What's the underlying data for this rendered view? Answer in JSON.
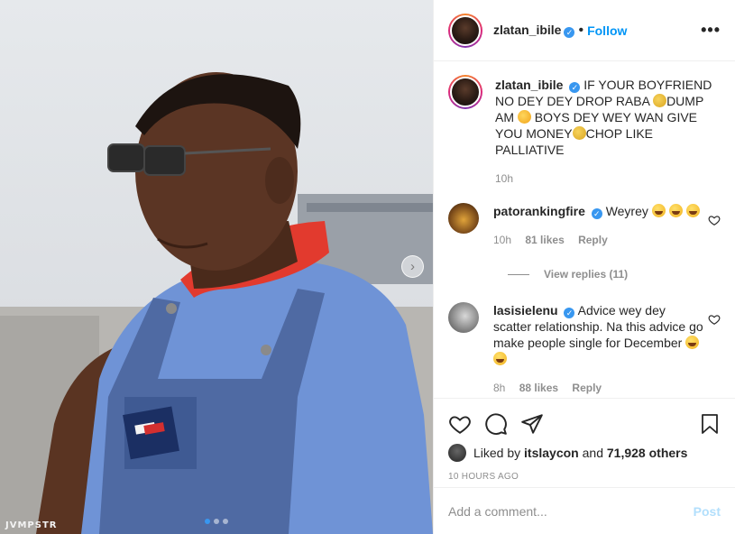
{
  "photo": {
    "watermark": "JVMPSTR",
    "next_arrow": "›",
    "carousel": {
      "slides": 3,
      "active": 1
    }
  },
  "header": {
    "username": "zlatan_ibile",
    "verified_glyph": "✓",
    "separator": "•",
    "follow_label": "Follow",
    "more_glyph": "•••"
  },
  "caption": {
    "username": "zlatan_ibile",
    "text_1": "IF YOUR BOYFRIEND NO DEY DEY DROP RABA ",
    "text_2": "DUMP AM ",
    "text_3": " BOYS DEY WEY WAN GIVE YOU MONEY",
    "text_4": "CHOP LIKE PALLIATIVE",
    "time": "10h"
  },
  "comments": [
    {
      "username": "patorankingfire",
      "text": "Weyrey ",
      "time": "10h",
      "likes": "81 likes",
      "reply_label": "Reply",
      "view_replies": "View replies (11)"
    },
    {
      "username": "lasisielenu",
      "text": "Advice wey dey scatter relationship. Na this advice go make people single for December ",
      "time": "8h",
      "likes": "88 likes",
      "reply_label": "Reply"
    }
  ],
  "actions": {
    "liked_prefix": "Liked by ",
    "liked_user": "itslaycon",
    "liked_and": " and ",
    "liked_count": "71,928 others",
    "time_ago": "10 HOURS AGO"
  },
  "add_comment": {
    "placeholder": "Add a comment...",
    "post_label": "Post"
  },
  "icons": [
    "heart-icon",
    "comment-icon",
    "share-icon",
    "bookmark-icon",
    "more-icon",
    "verified-icon",
    "chevron-right-icon"
  ],
  "colors": {
    "link_blue": "#0095f6",
    "verified_blue": "#3897f0",
    "muted": "#8e8e8e",
    "post_disabled": "#b2dffc"
  }
}
